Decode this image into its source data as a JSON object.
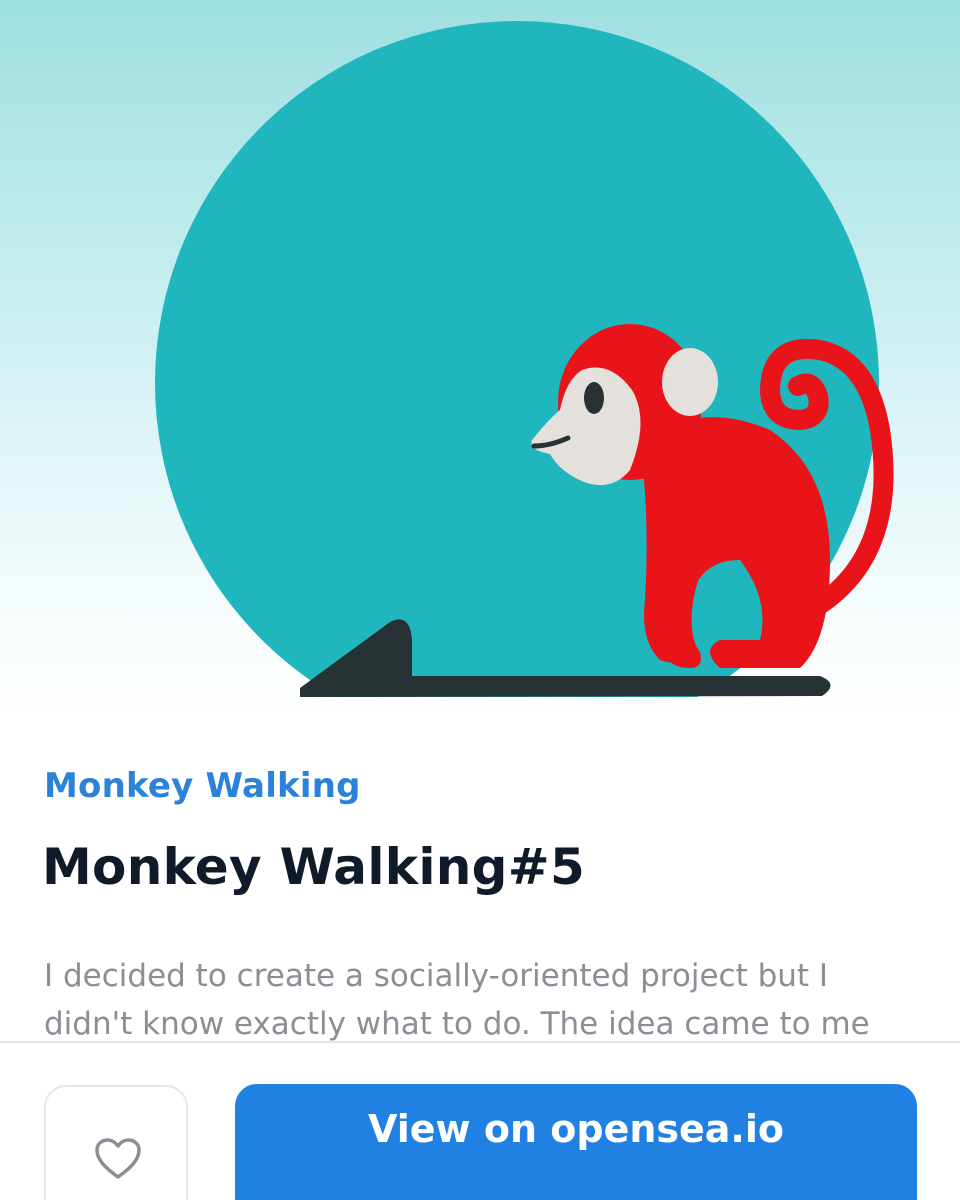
{
  "hero": {
    "image_name": "monkey-walking-artwork",
    "colors": {
      "circle": "#1fb7bd",
      "monkey": "#e8141a",
      "face": "#e4e0dc",
      "ground": "#263233"
    }
  },
  "collection": {
    "name": "Monkey Walking"
  },
  "item": {
    "title": "Monkey Walking#5",
    "description": "I decided to create a socially-oriented project but I didn't know exactly what to do. The idea came to me"
  },
  "actions": {
    "like_icon": "heart-icon",
    "view_label": "View on opensea.io"
  },
  "colors": {
    "accent": "#2181e2",
    "link": "#2b82d9",
    "title": "#0f1a2a",
    "muted": "#8a8f96"
  }
}
